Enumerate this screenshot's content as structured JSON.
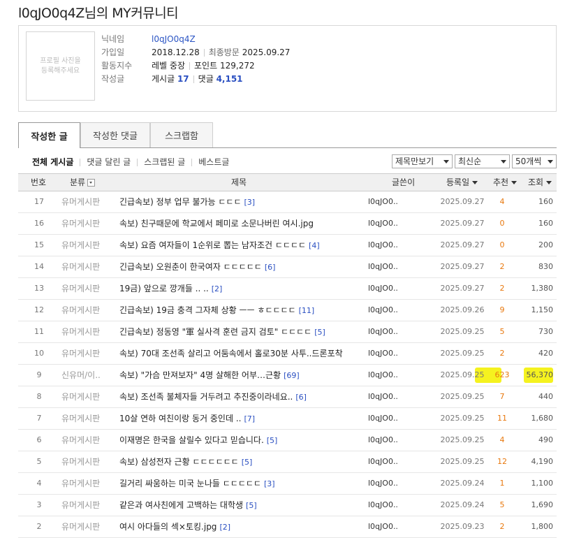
{
  "page": {
    "title": "l0qJO0q4Z님의 MY커뮤니티"
  },
  "profile": {
    "photo_placeholder": "프로필 사진을 등록해주세요",
    "nickname_label": "닉네임",
    "nickname": "l0qJO0q4Z",
    "joined_label": "가입일",
    "joined": "2018.12.28",
    "last_visit_label": "최종방문",
    "last_visit": "2025.09.27",
    "activity_label": "활동지수",
    "level_label": "레벨",
    "level": "중장",
    "point_label": "포인트",
    "points": "129,272",
    "written_label": "작성글",
    "posts_label": "게시글",
    "posts_count": "17",
    "comments_label": "댓글",
    "comments_count": "4,151"
  },
  "tabs": [
    {
      "label": "작성한 글",
      "active": true
    },
    {
      "label": "작성한 댓글",
      "active": false
    },
    {
      "label": "스크랩함",
      "active": false
    }
  ],
  "subnav": [
    {
      "label": "전체 게시글",
      "active": true
    },
    {
      "label": "댓글 달린 글",
      "active": false
    },
    {
      "label": "스크랩된 글",
      "active": false
    },
    {
      "label": "베스트글",
      "active": false
    }
  ],
  "filters": {
    "view_mode": "제목만보기",
    "sort": "최신순",
    "page_size": "50개씩"
  },
  "columns": {
    "no": "번호",
    "category": "분류",
    "title": "제목",
    "writer": "글쓴이",
    "date": "등록일",
    "recommend": "추천",
    "views": "조회"
  },
  "posts": [
    {
      "no": "17",
      "category": "유머게시판",
      "title": "긴급속보) 정부 업무 불가능 ㄷㄷㄷ",
      "comments": "[3]",
      "writer": "l0qJO0..",
      "date": "2025.09.27",
      "rec": "4",
      "views": "160"
    },
    {
      "no": "16",
      "category": "유머게시판",
      "title": "속보) 친구때문에 학교에서 페미로 소문나버린 여시.jpg",
      "comments": "",
      "writer": "l0qJO0..",
      "date": "2025.09.27",
      "rec": "0",
      "views": "160"
    },
    {
      "no": "15",
      "category": "유머게시판",
      "title": "속보) 요즘 여자들이 1순위로 뽑는 남자조건 ㄷㄷㄷㄷ",
      "comments": "[4]",
      "writer": "l0qJO0..",
      "date": "2025.09.27",
      "rec": "0",
      "views": "200"
    },
    {
      "no": "14",
      "category": "유머게시판",
      "title": "긴급속보) 오원춘이 한국여자 ㄷㄷㄷㄷㄷ",
      "comments": "[6]",
      "writer": "l0qJO0..",
      "date": "2025.09.27",
      "rec": "2",
      "views": "830"
    },
    {
      "no": "13",
      "category": "유머게시판",
      "title": "19금) 앞으로 깡개들 .. ..",
      "comments": "[2]",
      "writer": "l0qJO0..",
      "date": "2025.09.27",
      "rec": "2",
      "views": "1,380"
    },
    {
      "no": "12",
      "category": "유머게시판",
      "title": "긴급속보) 19금 충격 그자체 상황 ㅡㅡ ㅎㄷㄷㄷㄷ",
      "comments": "[11]",
      "writer": "l0qJO0..",
      "date": "2025.09.26",
      "rec": "9",
      "views": "1,150"
    },
    {
      "no": "11",
      "category": "유머게시판",
      "title": "긴급속보) 정동영 \"軍 실사격 훈련 금지 검토\" ㄷㄷㄷㄷ",
      "comments": "[5]",
      "writer": "l0qJO0..",
      "date": "2025.09.25",
      "rec": "5",
      "views": "730"
    },
    {
      "no": "10",
      "category": "유머게시판",
      "title": "속보) 70대 조선족 살리고 어둠속에서 홀로30분 사투..드론포착",
      "comments": "",
      "writer": "l0qJO0..",
      "date": "2025.09.25",
      "rec": "2",
      "views": "420"
    },
    {
      "no": "9",
      "category": "신유머/이..",
      "title": "속보) \"가슴 만져보자\" 4명 살해한 어부…근황",
      "comments": "[69]",
      "writer": "l0qJO0..",
      "date": "2025.09.25",
      "rec": "623",
      "views": "56,370"
    },
    {
      "no": "8",
      "category": "유머게시판",
      "title": "속보) 조선족 불체자들 거두려고 추진중이라네요..",
      "comments": "[6]",
      "writer": "l0qJO0..",
      "date": "2025.09.25",
      "rec": "7",
      "views": "440"
    },
    {
      "no": "7",
      "category": "유머게시판",
      "title": "10살 연하 여친이랑 동거 중인데 ..",
      "comments": "[7]",
      "writer": "l0qJO0..",
      "date": "2025.09.25",
      "rec": "11",
      "views": "1,680"
    },
    {
      "no": "6",
      "category": "유머게시판",
      "title": "이재명은 한국을 살릴수 있다고 믿습니다.",
      "comments": "[5]",
      "writer": "l0qJO0..",
      "date": "2025.09.25",
      "rec": "4",
      "views": "490"
    },
    {
      "no": "5",
      "category": "유머게시판",
      "title": "속보) 삼성전자 근황 ㄷㄷㄷㄷㄷㄷ",
      "comments": "[5]",
      "writer": "l0qJO0..",
      "date": "2025.09.25",
      "rec": "12",
      "views": "4,190"
    },
    {
      "no": "4",
      "category": "유머게시판",
      "title": "길거리 싸움하는 미국 눈나들 ㄷㄷㄷㄷㄷ",
      "comments": "[3]",
      "writer": "l0qJO0..",
      "date": "2025.09.24",
      "rec": "1",
      "views": "1,100"
    },
    {
      "no": "3",
      "category": "유머게시판",
      "title": "같은과 여사친에게 고백하는 대학생",
      "comments": "[5]",
      "writer": "l0qJO0..",
      "date": "2025.09.24",
      "rec": "5",
      "views": "1,690"
    },
    {
      "no": "2",
      "category": "유머게시판",
      "title": "여시 아다들의 섹×토킹.jpg",
      "comments": "[2]",
      "writer": "l0qJO0..",
      "date": "2025.09.23",
      "rec": "2",
      "views": "1,800"
    }
  ],
  "highlight": {
    "color": "#f5f21f"
  }
}
